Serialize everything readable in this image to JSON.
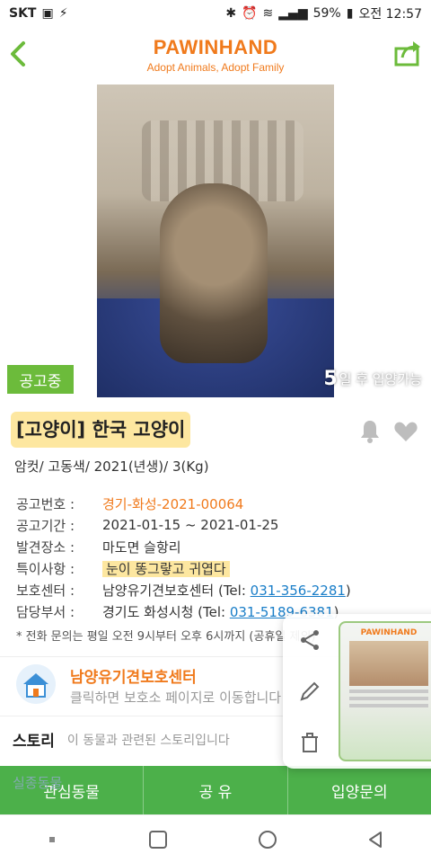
{
  "status_bar": {
    "carrier": "SKT",
    "battery": "59%",
    "time": "오전 12:57"
  },
  "header": {
    "brand": "PAWINHAND",
    "tagline": "Adopt Animals, Adopt Family"
  },
  "photo": {
    "status_badge": "공고중",
    "days_number": "5",
    "days_text": "일 후 입양가능"
  },
  "animal": {
    "title": "[고양이] 한국 고양이",
    "summary": "암컷/ 고동색/ 2021(년생)/ 3(Kg)"
  },
  "details": [
    {
      "label": "공고번호 :",
      "value": "경기-화성-2021-00064"
    },
    {
      "label": "공고기간 :",
      "value": "2021-01-15 ~ 2021-01-25"
    },
    {
      "label": "발견장소 :",
      "value": "마도면 슬항리"
    },
    {
      "label": "특이사항 :",
      "value": "눈이 똥그랗고 귀엽다"
    },
    {
      "label": "보호센터 :",
      "value": "남양유기견보호센터 (Tel: ",
      "tel": "031-356-2281",
      "suffix": ")"
    },
    {
      "label": "담당부서 :",
      "value": "경기도 화성시청 (Tel: ",
      "tel": "031-5189-6381",
      "suffix": ")"
    }
  ],
  "notice": "* 전화 문의는 평일 오전 9시부터 오후 6시까지 (공휴일 제외)",
  "shelter": {
    "name": "남양유기견보호센터",
    "description": "클릭하면 보호소 페이지로 이동합니다"
  },
  "story": {
    "label": "스토리",
    "description": "이 동물과 관련된 스토리입니다"
  },
  "missing_peek": "실종동물",
  "bottom_actions": [
    "관심동물",
    "공 유",
    "입양문의"
  ],
  "floating_panel": {
    "thumb_brand": "PAWINHAND"
  },
  "colors": {
    "brand_orange": "#f07a1c",
    "action_green": "#4cb04a",
    "badge_green": "#6cbb3b",
    "highlight_yellow": "#fde7a0",
    "link_blue": "#1a7ec8"
  }
}
